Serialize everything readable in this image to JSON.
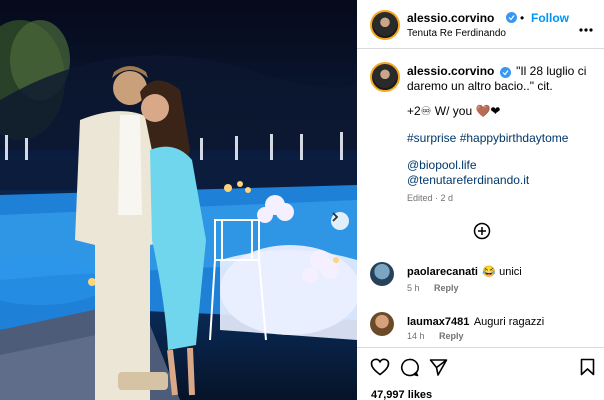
{
  "post": {
    "username": "alessio.corvino",
    "follow_label": "Follow",
    "separator": "•",
    "location": "Tenuta Re Ferdinando",
    "caption_text": "\"Il 28 luglio ci daremo un altro bacio..\" cit.",
    "caption_line2": "+2♾ W/ you 🤎❤",
    "hashtags": "#surprise #happybirthdaytome",
    "mention1": "@biopool.life",
    "mention2": "@tenutareferdinando.it",
    "edited": "Edited · 2 d"
  },
  "comments": [
    {
      "user": "paolarecanati",
      "text": "😂 unici",
      "time": "5 h",
      "reply": "Reply"
    },
    {
      "user": "laumax7481",
      "text": "Auguri ragazzi",
      "time": "14 h",
      "reply": "Reply"
    }
  ],
  "footer": {
    "likes": "47,997 likes"
  },
  "icons": {
    "more": "more-options-icon",
    "add": "add-comment-icon",
    "like": "heart-icon",
    "comment": "comment-icon",
    "share": "share-icon",
    "save": "bookmark-icon",
    "next": "chevron-right-icon"
  },
  "colors": {
    "accent": "#0095f6",
    "verified": "#3897f0",
    "link": "#00376b",
    "meta": "#737373"
  }
}
